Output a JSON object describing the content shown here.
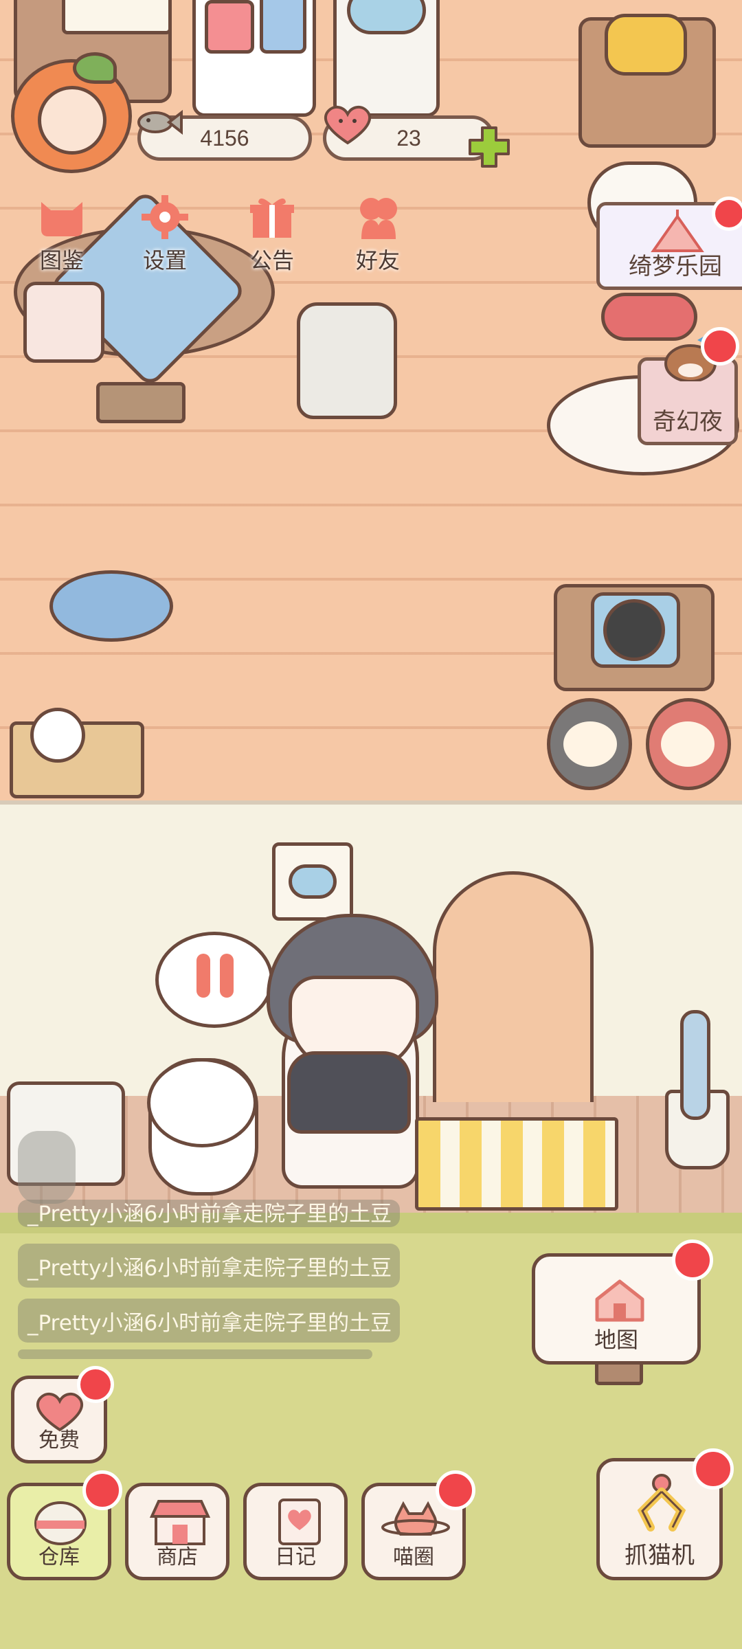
{
  "stats": {
    "fish_count": "4156",
    "hearts_count": "23"
  },
  "top_menu": {
    "catalog_label": "图鉴",
    "settings_label": "设置",
    "notice_label": "公告",
    "friends_label": "好友"
  },
  "events": {
    "dream_park_label": "绮梦乐园",
    "fantasy_night_label": "奇幻夜"
  },
  "feed": {
    "partial_item": "_Pretty小涵6小时前拿走院子里的土豆",
    "items": [
      "_Pretty小涵6小时前拿走院子里的土豆",
      "_Pretty小涵6小时前拿走院子里的土豆"
    ]
  },
  "map_button": {
    "label": "地图"
  },
  "free_button": {
    "label": "免费"
  },
  "bottom_nav": {
    "warehouse": "仓库",
    "shop": "商店",
    "diary": "日记",
    "meow_circle": "喵圈",
    "claw_machine": "抓猫机"
  },
  "colors": {
    "badge_red": "#f0454a",
    "plus_green": "#9ccc3c",
    "button_outline": "#6b4a3d"
  }
}
